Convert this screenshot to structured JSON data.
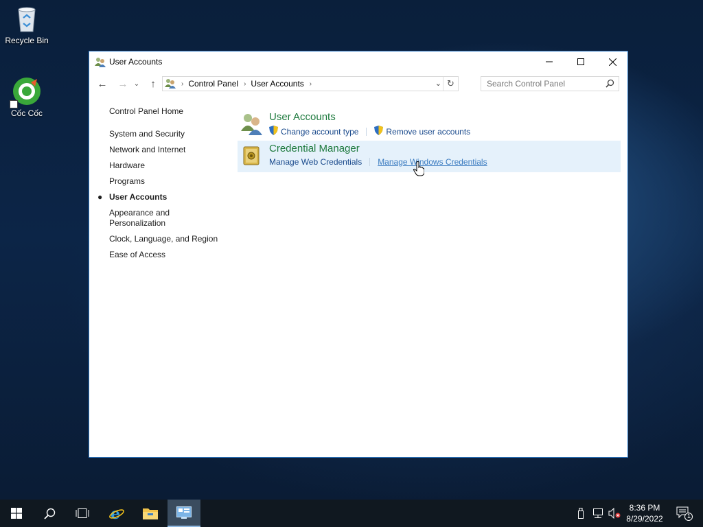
{
  "desktop": {
    "icons": [
      {
        "label": "Recycle Bin"
      },
      {
        "label": "Cốc Cốc"
      }
    ]
  },
  "window": {
    "title": "User Accounts",
    "controls": {
      "minimize": "—",
      "maximize": "☐",
      "close": "✕"
    },
    "address": {
      "crumbs": [
        "Control Panel",
        "User Accounts"
      ]
    },
    "search": {
      "placeholder": "Search Control Panel"
    },
    "left_pane": {
      "home": "Control Panel Home",
      "items": [
        "System and Security",
        "Network and Internet",
        "Hardware",
        "Programs",
        "User Accounts",
        "Appearance and Personalization",
        "Clock, Language, and Region",
        "Ease of Access"
      ],
      "active_index": 4
    },
    "categories": [
      {
        "title": "User Accounts",
        "links": [
          "Change account type",
          "Remove user accounts"
        ]
      },
      {
        "title": "Credential Manager",
        "links": [
          "Manage Web Credentials",
          "Manage Windows Credentials"
        ]
      }
    ]
  },
  "taskbar": {
    "clock": {
      "time": "8:36 PM",
      "date": "8/29/2022"
    },
    "notification_count": "1"
  },
  "colors": {
    "category_title": "#1e7a3e",
    "link": "#1a4a8c",
    "hover_bg": "#e5f1fb",
    "window_border": "#2b78c4"
  }
}
